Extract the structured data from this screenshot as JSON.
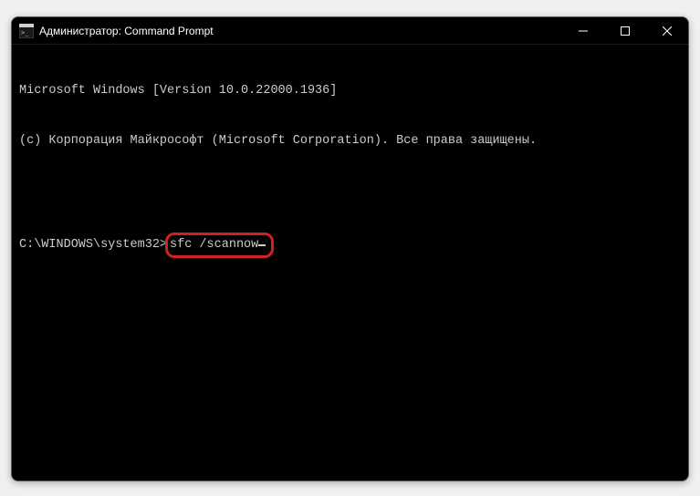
{
  "titlebar": {
    "title": "Администратор: Command Prompt"
  },
  "terminal": {
    "line1": "Microsoft Windows [Version 10.0.22000.1936]",
    "line2": "(c) Корпорация Майкрософт (Microsoft Corporation). Все права защищены.",
    "prompt": "C:\\WINDOWS\\system32>",
    "command": "sfc /scannow"
  }
}
